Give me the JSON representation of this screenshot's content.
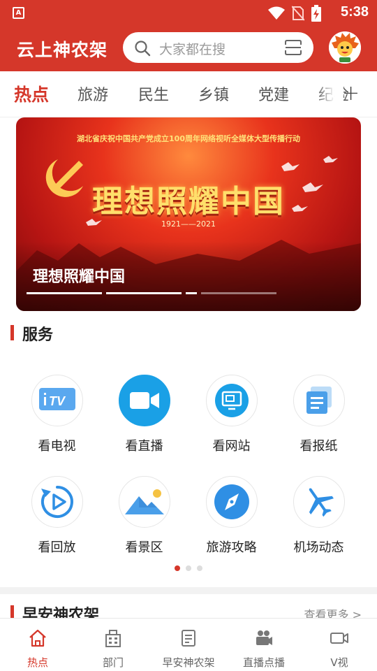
{
  "status_bar": {
    "app_badge": "A",
    "time": "5:38"
  },
  "header": {
    "brand": "云上神农架",
    "search_placeholder": "大家都在搜"
  },
  "tabs": [
    {
      "label": "热点",
      "active": true
    },
    {
      "label": "旅游"
    },
    {
      "label": "民生"
    },
    {
      "label": "乡镇"
    },
    {
      "label": "党建"
    },
    {
      "label": "纪检"
    }
  ],
  "tab_add": "+",
  "banner": {
    "subtitle": "湖北省庆祝中国共产党成立100周年网络视听全媒体大型传播行动",
    "headline": "理想照耀中国",
    "years": "1921——2021",
    "caption": "理想照耀中国",
    "slide_count": 4,
    "active_slide": 3
  },
  "services": {
    "title": "服务",
    "items": [
      {
        "label": "看电视",
        "icon": "tv-icon"
      },
      {
        "label": "看直播",
        "icon": "video-camera-icon"
      },
      {
        "label": "看网站",
        "icon": "website-icon"
      },
      {
        "label": "看报纸",
        "icon": "newspaper-icon"
      },
      {
        "label": "看回放",
        "icon": "replay-icon"
      },
      {
        "label": "看景区",
        "icon": "scenery-icon"
      },
      {
        "label": "旅游攻略",
        "icon": "compass-icon"
      },
      {
        "label": "机场动态",
        "icon": "airplane-icon"
      }
    ],
    "page_count": 3,
    "active_page": 1
  },
  "news_section": {
    "title": "早安神农架",
    "more": "查看更多 >"
  },
  "bottom_nav": [
    {
      "label": "热点",
      "icon": "home-icon",
      "active": true
    },
    {
      "label": "部门",
      "icon": "building-icon"
    },
    {
      "label": "早安神农架",
      "icon": "notepad-icon"
    },
    {
      "label": "直播点播",
      "icon": "live-camera-icon"
    },
    {
      "label": "V视",
      "icon": "video-icon"
    }
  ],
  "colors": {
    "brand_red": "#d5372a",
    "icon_blue": "#2f8fe4"
  }
}
